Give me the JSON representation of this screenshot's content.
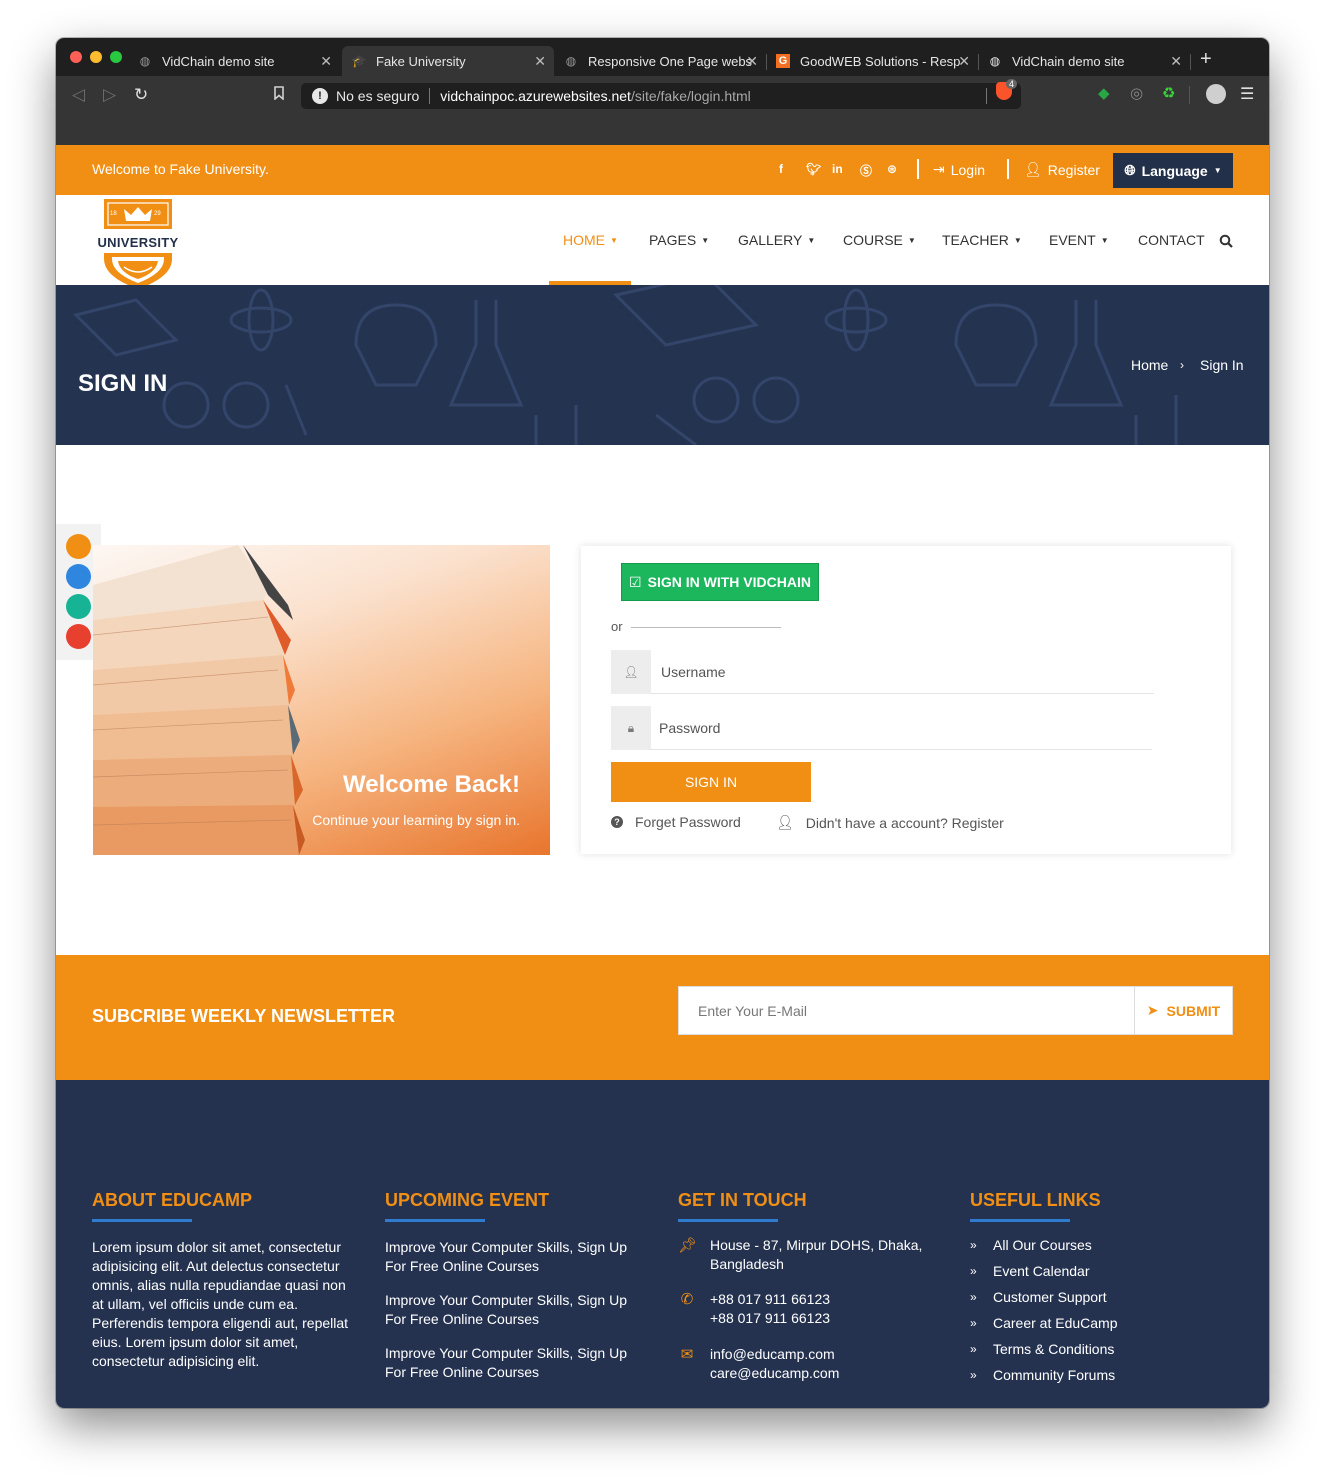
{
  "browser": {
    "tabs": [
      {
        "title": "VidChain demo site",
        "active": false
      },
      {
        "title": "Fake University",
        "active": true
      },
      {
        "title": "Responsive One Page webs",
        "active": false
      },
      {
        "title": "GoodWEB Solutions - Resp",
        "active": false
      },
      {
        "title": "VidChain demo site",
        "active": false
      }
    ],
    "address_security": "No es seguro",
    "address_host": "vidchainpoc.azurewebsites.net",
    "address_path": "/site/fake/login.html",
    "shield_count": "4"
  },
  "topbar": {
    "welcome": "Welcome to Fake University.",
    "login": "Login",
    "register": "Register",
    "language": "Language"
  },
  "logo": {
    "text": "UNIVERSITY",
    "year_left": "18",
    "year_right": "29"
  },
  "nav": {
    "home": "HOME",
    "pages": "PAGES",
    "gallery": "GALLERY",
    "course": "COURSE",
    "teacher": "TEACHER",
    "event": "EVENT",
    "contact": "CONTACT"
  },
  "banner": {
    "title": "SIGN IN",
    "crumb_home": "Home",
    "crumb_current": "Sign In"
  },
  "theme_colors": [
    "#f18f14",
    "#2e86de",
    "#16b394",
    "#e8402f"
  ],
  "hero": {
    "title": "Welcome Back!",
    "subtitle": "Continue your learning by sign in."
  },
  "form": {
    "vidchain_button": "SIGN IN WITH VIDCHAIN",
    "or": "or",
    "username_placeholder": "Username",
    "password_placeholder": "Password",
    "signin_button": "SIGN IN",
    "forget_password": "Forget Password",
    "register_link": "Didn't have a account? Register"
  },
  "newsletter": {
    "title": "SUBCRIBE WEEKLY NEWSLETTER",
    "email_placeholder": "Enter Your E-Mail",
    "submit": "SUBMIT"
  },
  "footer": {
    "about": {
      "heading": "ABOUT EDUCAMP",
      "text": "Lorem ipsum dolor sit amet, consectetur adipisicing elit. Aut delectus consectetur omnis, alias nulla repudiandae quasi non at ullam, vel officiis unde cum ea. Perferendis tempora eligendi aut, repellat eius. Lorem ipsum dolor sit amet, consectetur adipisicing elit."
    },
    "events": {
      "heading": "UPCOMING EVENT",
      "items": [
        "Improve Your Computer Skills, Sign Up For Free Online Courses",
        "Improve Your Computer Skills, Sign Up For Free Online Courses",
        "Improve Your Computer Skills, Sign Up For Free Online Courses"
      ]
    },
    "contact": {
      "heading": "GET IN TOUCH",
      "address": "House - 87, Mirpur DOHS, Dhaka, Bangladesh",
      "phone1": "+88 017 911 66123",
      "phone2": "+88 017 911 66123",
      "email1": "info@educamp.com",
      "email2": "care@educamp.com"
    },
    "links": {
      "heading": "USEFUL LINKS",
      "items": [
        "All Our Courses",
        "Event Calendar",
        "Customer Support",
        "Career at EduCamp",
        "Terms & Conditions",
        "Community Forums"
      ]
    }
  }
}
